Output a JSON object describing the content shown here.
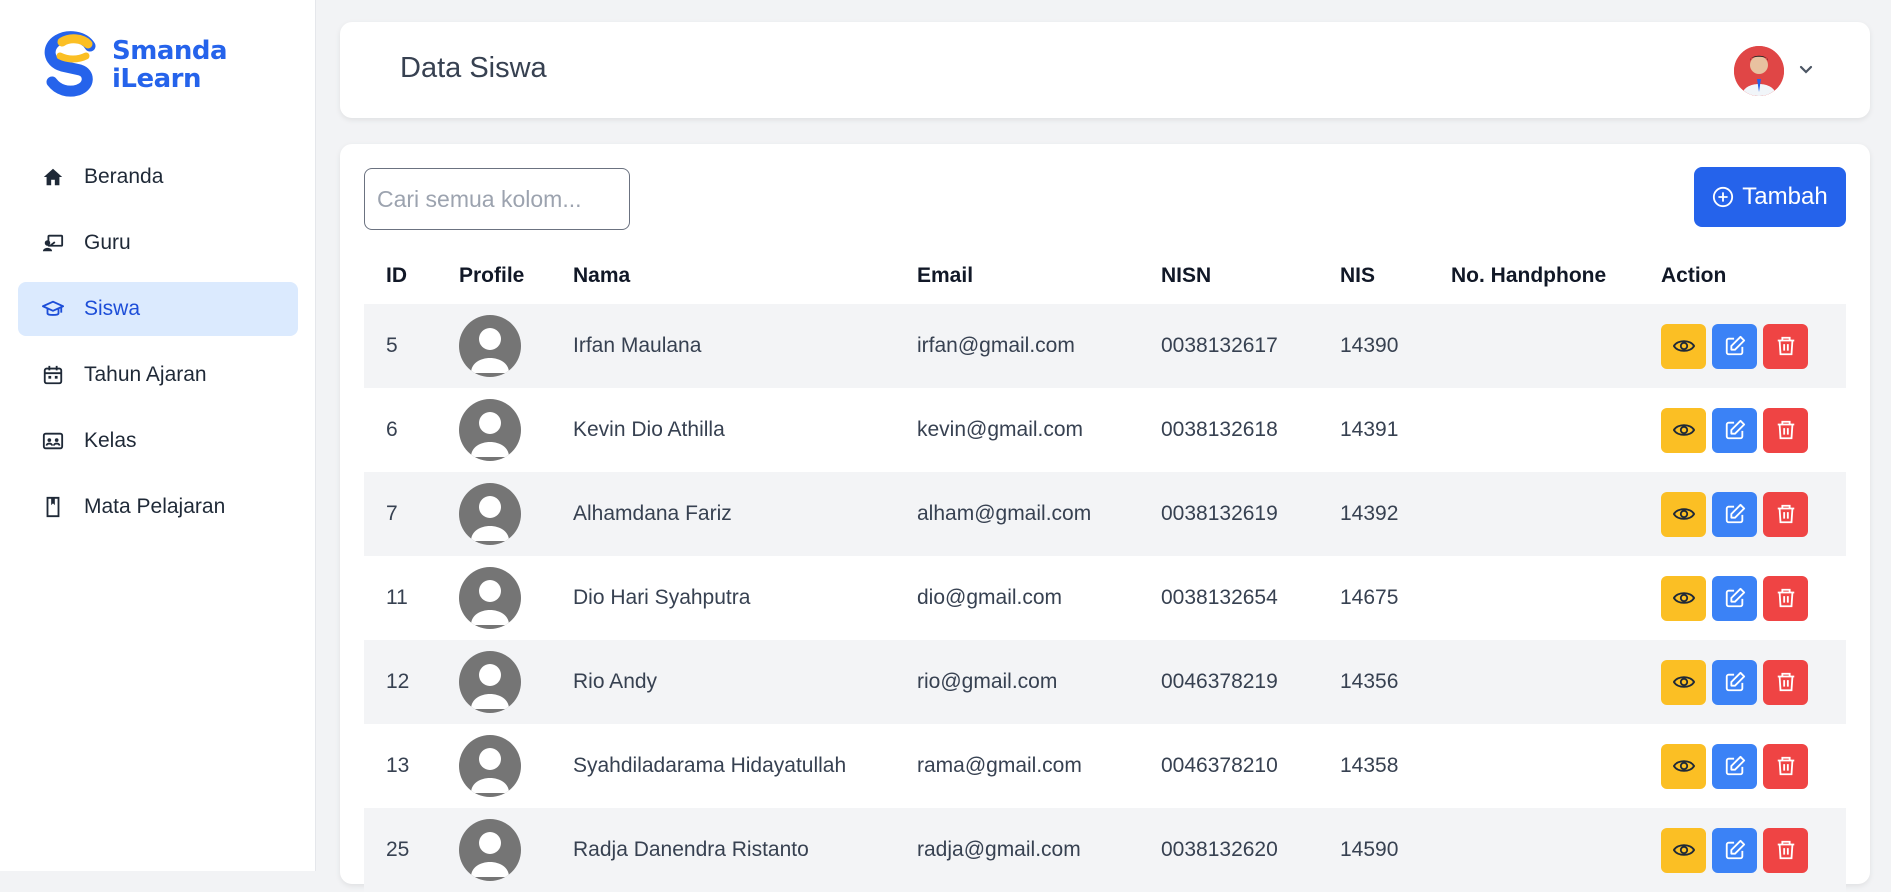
{
  "app": {
    "brand_line1": "Smanda",
    "brand_line2": "iLearn",
    "brand_color": "#2563eb"
  },
  "sidebar": {
    "items": [
      {
        "label": "Beranda",
        "icon": "home-icon",
        "active": false
      },
      {
        "label": "Guru",
        "icon": "teacher-icon",
        "active": false
      },
      {
        "label": "Siswa",
        "icon": "graduation-cap-icon",
        "active": true
      },
      {
        "label": "Tahun Ajaran",
        "icon": "calendar-icon",
        "active": false
      },
      {
        "label": "Kelas",
        "icon": "classroom-icon",
        "active": false
      },
      {
        "label": "Mata Pelajaran",
        "icon": "book-icon",
        "active": false
      }
    ]
  },
  "header": {
    "title": "Data Siswa"
  },
  "toolbar": {
    "search_placeholder": "Cari semua kolom...",
    "add_label": "Tambah"
  },
  "table": {
    "columns": [
      "ID",
      "Profile",
      "Nama",
      "Email",
      "NISN",
      "NIS",
      "No. Handphone",
      "Action"
    ],
    "rows": [
      {
        "id": "5",
        "nama": "Irfan Maulana",
        "email": "irfan@gmail.com",
        "nisn": "0038132617",
        "nis": "14390",
        "hp": ""
      },
      {
        "id": "6",
        "nama": "Kevin Dio Athilla",
        "email": "kevin@gmail.com",
        "nisn": "0038132618",
        "nis": "14391",
        "hp": ""
      },
      {
        "id": "7",
        "nama": "Alhamdana Fariz",
        "email": "alham@gmail.com",
        "nisn": "0038132619",
        "nis": "14392",
        "hp": ""
      },
      {
        "id": "11",
        "nama": "Dio Hari Syahputra",
        "email": "dio@gmail.com",
        "nisn": "0038132654",
        "nis": "14675",
        "hp": ""
      },
      {
        "id": "12",
        "nama": "Rio Andy",
        "email": "rio@gmail.com",
        "nisn": "0046378219",
        "nis": "14356",
        "hp": ""
      },
      {
        "id": "13",
        "nama": "Syahdiladarama Hidayatullah",
        "email": "rama@gmail.com",
        "nisn": "0046378210",
        "nis": "14358",
        "hp": ""
      },
      {
        "id": "25",
        "nama": "Radja Danendra Ristanto",
        "email": "radja@gmail.com",
        "nisn": "0038132620",
        "nis": "14590",
        "hp": ""
      }
    ]
  },
  "colors": {
    "view": "#fbbf24",
    "edit": "#3b82f6",
    "delete": "#ef4444",
    "active_nav": "#dbeafe"
  }
}
